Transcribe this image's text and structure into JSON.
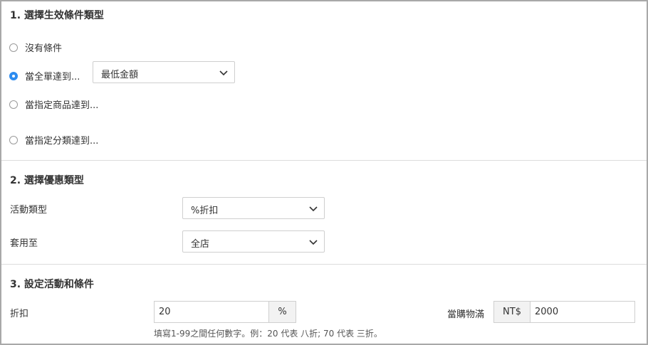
{
  "section1": {
    "title": "1. 選擇生效條件類型",
    "options": [
      {
        "label": "沒有條件",
        "checked": false
      },
      {
        "label": "當全單達到...",
        "checked": true
      },
      {
        "label": "當指定商品達到...",
        "checked": false
      },
      {
        "label": "當指定分類達到...",
        "checked": false
      }
    ],
    "condition_select": {
      "value": "最低金額"
    }
  },
  "section2": {
    "title": "2. 選擇優惠類型",
    "activity_type": {
      "label": "活動類型",
      "value": "%折扣"
    },
    "apply_to": {
      "label": "套用至",
      "value": "全店"
    }
  },
  "section3": {
    "title": "3. 設定活動和條件",
    "discount": {
      "label": "折扣",
      "value": "20",
      "unit": "%",
      "hint": "填寫1-99之間任何數字。例：20 代表 八折; 70 代表 三折。"
    },
    "threshold": {
      "label": "當購物滿",
      "currency": "NT$",
      "value": "2000"
    }
  },
  "colors": {
    "accent": "#2d8cf0",
    "border": "#cfcfcf",
    "frame": "#a9a9a9"
  },
  "icons": {
    "dropdown": "chevron-down-icon"
  }
}
